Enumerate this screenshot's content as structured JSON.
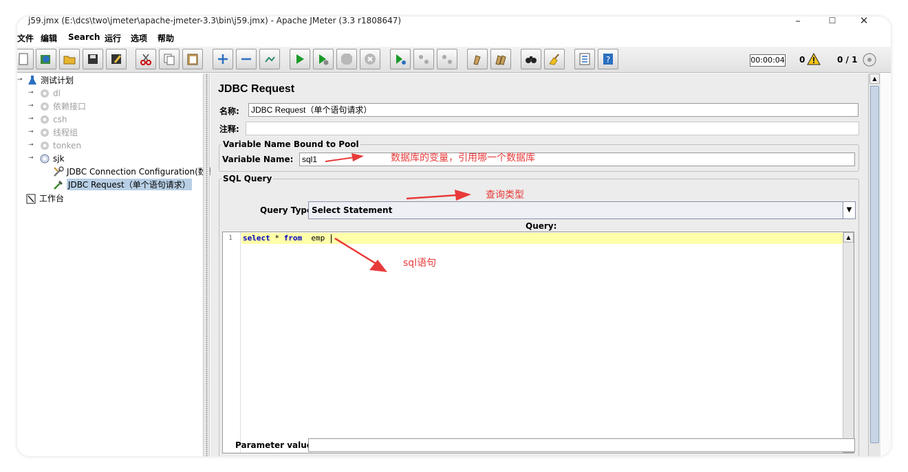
{
  "window": {
    "title": "j59.jmx (E:\\dcs\\two\\jmeter\\apache-jmeter-3.3\\bin\\j59.jmx) - Apache JMeter (3.3 r1808647)",
    "minimize": "–",
    "maximize": "☐",
    "close": "✕"
  },
  "menu": [
    "文件",
    "编辑",
    "Search",
    "运行",
    "选项",
    "帮助"
  ],
  "toolbar": {
    "timer": "00:00:04",
    "warnings": "0",
    "threads": "0 / 1"
  },
  "tree": {
    "root": "测试计划",
    "items": [
      {
        "label": "dl",
        "disabled": true
      },
      {
        "label": "依赖接口",
        "disabled": true
      },
      {
        "label": "csh",
        "disabled": true
      },
      {
        "label": "线程组",
        "disabled": true
      },
      {
        "label": "tonken",
        "disabled": true
      },
      {
        "label": "sjk",
        "disabled": false
      }
    ],
    "children": [
      {
        "label": "JDBC Connection Configuration(数据",
        "icon": "wrench-icon"
      },
      {
        "label": "JDBC Request（单个语句请求）",
        "icon": "pipette-icon",
        "selected": true
      }
    ],
    "workbench": "工作台"
  },
  "panel": {
    "title": "JDBC Request",
    "name_label": "名称:",
    "name_value": "JDBC Request（单个语句请求）",
    "comment_label": "注释:",
    "comment_value": "",
    "pool_group": "Variable Name Bound to Pool",
    "var_label": "Variable Name:",
    "var_value": "sql1",
    "sql_group": "SQL Query",
    "query_type_label": "Query Type:",
    "query_type_value": "Select Statement",
    "query_label": "Query:",
    "line_number": "1",
    "code_kw1": "select",
    "code_mid": " * ",
    "code_kw2": "from",
    "code_rest": "  emp ",
    "param_label": "Parameter values:",
    "param_value": ""
  },
  "annotations": {
    "var_note": "数据库的变量，引用哪一个数据库",
    "type_note": "查询类型",
    "sql_note": "sql语句",
    "color": "#e83a3a"
  }
}
